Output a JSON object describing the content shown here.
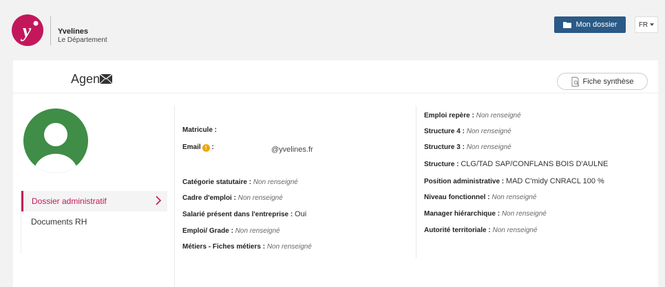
{
  "brand": {
    "name": "Yvelines",
    "subtitle": "Le Département"
  },
  "header": {
    "dossier_label": "Mon dossier",
    "lang": "FR"
  },
  "agent": {
    "title": "Agent",
    "fiche_label": "Fiche synthèse"
  },
  "nav": {
    "items": [
      {
        "label": "Dossier administratif"
      },
      {
        "label": "Documents RH"
      }
    ]
  },
  "left_fields": {
    "matricule": {
      "label": "Matricule :"
    },
    "email": {
      "label": "Email",
      "colon": " :",
      "info": "!",
      "domain": "@yvelines.fr"
    },
    "categorie": {
      "label": "Catégorie statutaire :",
      "value": "Non renseigné"
    },
    "cadre": {
      "label": "Cadre d'emploi :",
      "value": "Non renseigné"
    },
    "salarie": {
      "label": "Salarié présent dans l'entreprise :",
      "value": "Oui"
    },
    "emploi_grade": {
      "label": "Emploi/ Grade :",
      "value": "Non renseigné"
    },
    "metiers": {
      "label": "Métiers - Fiches métiers :",
      "value": "Non renseigné"
    }
  },
  "right_fields": {
    "emploi_repere": {
      "label": "Emploi repère :",
      "value": "Non renseigné"
    },
    "structure4": {
      "label": "Structure 4 :",
      "value": "Non renseigné"
    },
    "structure3": {
      "label": "Structure 3 :",
      "value": "Non renseigné"
    },
    "structure": {
      "label": "Structure :",
      "value": "CLG/TAD SAP/CONFLANS BOIS D'AULNE"
    },
    "position": {
      "label": "Position administrative :",
      "value": "MAD C'midy CNRACL 100 %"
    },
    "niveau": {
      "label": "Niveau fonctionnel :",
      "value": "Non renseigné"
    },
    "manager": {
      "label": "Manager hiérarchique :",
      "value": "Non renseigné"
    },
    "autorite": {
      "label": "Autorité territoriale :",
      "value": "Non renseigné"
    }
  },
  "colors": {
    "brand_magenta": "#c2185b",
    "button_blue": "#2a5a86",
    "avatar_green": "#3f8d46",
    "info_orange": "#f0a500"
  },
  "icons": [
    "yvelines-logo-icon",
    "folder-icon",
    "caret-down-icon",
    "mail-icon",
    "document-search-icon",
    "user-avatar-icon",
    "chevron-right-icon",
    "info-icon"
  ]
}
